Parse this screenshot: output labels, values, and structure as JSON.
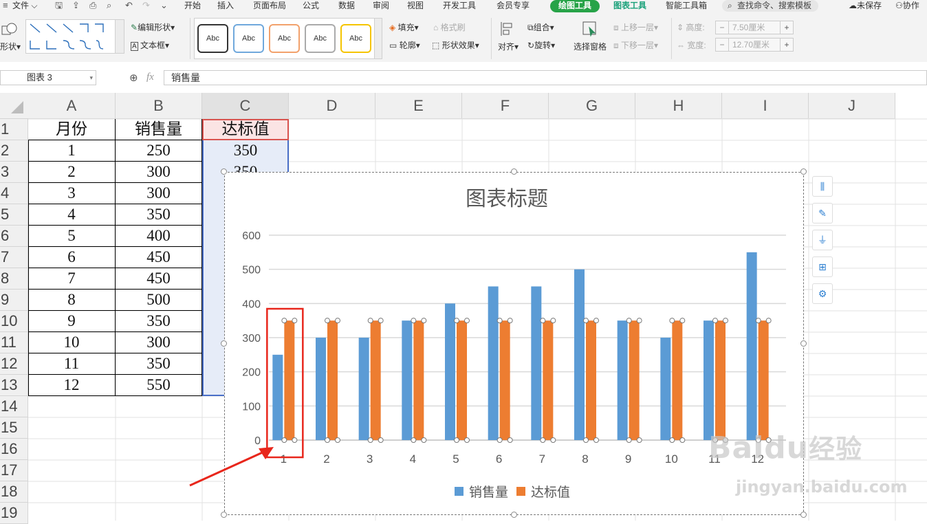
{
  "menu_bar": {
    "file_label": "文件",
    "tabs": [
      {
        "label": "开始",
        "x": 268
      },
      {
        "label": "插入",
        "x": 316
      },
      {
        "label": "页面布局",
        "x": 368
      },
      {
        "label": "公式",
        "x": 440
      },
      {
        "label": "数据",
        "x": 492
      },
      {
        "label": "审阅",
        "x": 542
      },
      {
        "label": "视图",
        "x": 592
      },
      {
        "label": "开发工具",
        "x": 644
      },
      {
        "label": "会员专享",
        "x": 722
      }
    ],
    "drawing_tools": "绘图工具",
    "chart_tools": "图表工具",
    "smart_toolbox": "智能工具箱",
    "search_placeholder": "查找命令、搜索模板",
    "unsaved": "未保存",
    "collaborate": "协作"
  },
  "ribbon": {
    "shape_label": "形状",
    "edit_shape": "编辑形状",
    "text_box": "文本框",
    "style_samples": [
      "Abc",
      "Abc",
      "Abc",
      "Abc",
      "Abc"
    ],
    "fill": "填充",
    "outline": "轮廓",
    "format_brush": "格式刷",
    "shape_effects": "形状效果",
    "align": "对齐",
    "group": "组合",
    "rotate": "旋转",
    "selection_pane": "选择窗格",
    "bring_forward": "上移一层",
    "send_backward": "下移一层",
    "height_label": "高度:",
    "height_value": "7.50厘米",
    "width_label": "宽度:",
    "width_value": "12.70厘米"
  },
  "formula_bar": {
    "name_box": "图表 3",
    "fx": "fx",
    "content": "销售量"
  },
  "sheet": {
    "columns": [
      "A",
      "B",
      "C",
      "D",
      "E",
      "F",
      "G",
      "H",
      "I",
      "J"
    ],
    "rows": [
      "1",
      "2",
      "3",
      "4",
      "5",
      "6",
      "7",
      "8",
      "9",
      "10",
      "11",
      "12",
      "13",
      "14",
      "15",
      "16",
      "17",
      "18",
      "19"
    ],
    "headers": [
      "月份",
      "销售量",
      "达标值"
    ],
    "months": [
      "1",
      "2",
      "3",
      "4",
      "5",
      "6",
      "7",
      "8",
      "9",
      "10",
      "11",
      "12"
    ],
    "sales": [
      "250",
      "300",
      "300",
      "350",
      "400",
      "450",
      "450",
      "500",
      "350",
      "300",
      "350",
      "550"
    ],
    "target_c2": "350",
    "target_c3_partial": "350"
  },
  "chart_data": {
    "type": "bar",
    "title": "图表标题",
    "categories": [
      "1",
      "2",
      "3",
      "4",
      "5",
      "6",
      "7",
      "8",
      "9",
      "10",
      "11",
      "12"
    ],
    "series": [
      {
        "name": "销售量",
        "values": [
          250,
          300,
          300,
          350,
          400,
          450,
          450,
          500,
          350,
          300,
          350,
          550
        ],
        "color": "#5b9bd5"
      },
      {
        "name": "达标值",
        "values": [
          350,
          350,
          350,
          350,
          350,
          350,
          350,
          350,
          350,
          350,
          350,
          350
        ],
        "color": "#ed7d31"
      }
    ],
    "ylim": [
      0,
      600
    ],
    "yticks": [
      0,
      100,
      200,
      300,
      400,
      500,
      600
    ],
    "grid": true,
    "legend": "bottom",
    "highlight_category": "1"
  },
  "watermark": {
    "brand": "Baidu",
    "jingyan": "经验",
    "url": "jingyan.baidu.com"
  }
}
